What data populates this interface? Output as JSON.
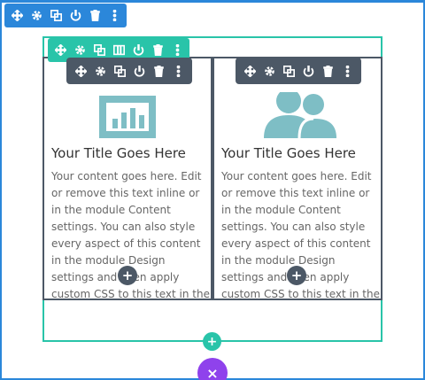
{
  "colors": {
    "section_blue": "#2b87da",
    "row_green": "#29c4a9",
    "module_dark": "#4c5866",
    "close_purple": "#8f42ec",
    "icon_teal": "#7ebec5"
  },
  "section_toolbar": {
    "icons": [
      "move-icon",
      "gear-icon",
      "duplicate-icon",
      "power-icon",
      "trash-icon",
      "more-icon"
    ]
  },
  "row_toolbar": {
    "icons": [
      "move-icon",
      "gear-icon",
      "duplicate-icon",
      "columns-icon",
      "power-icon",
      "trash-icon",
      "more-icon"
    ]
  },
  "module_toolbar": {
    "icons": [
      "move-icon",
      "gear-icon",
      "duplicate-icon",
      "power-icon",
      "trash-icon",
      "more-icon"
    ]
  },
  "modules": [
    {
      "icon": "bar-chart-icon",
      "title": "Your Title Goes Here",
      "body": "Your content goes here. Edit or remove this text inline or in the module Content settings. You can also style every aspect of this content in the module Design settings and even apply custom CSS to this text in the module Advanced settings."
    },
    {
      "icon": "users-icon",
      "title": "Your Title Goes Here",
      "body": "Your content goes here. Edit or remove this text inline or in the module Content settings. You can also style every aspect of this content in the module Design settings and even apply custom CSS to this text in the module Advanced settings."
    }
  ],
  "buttons": {
    "add_module": "+",
    "add_row": "+",
    "close": "×"
  }
}
